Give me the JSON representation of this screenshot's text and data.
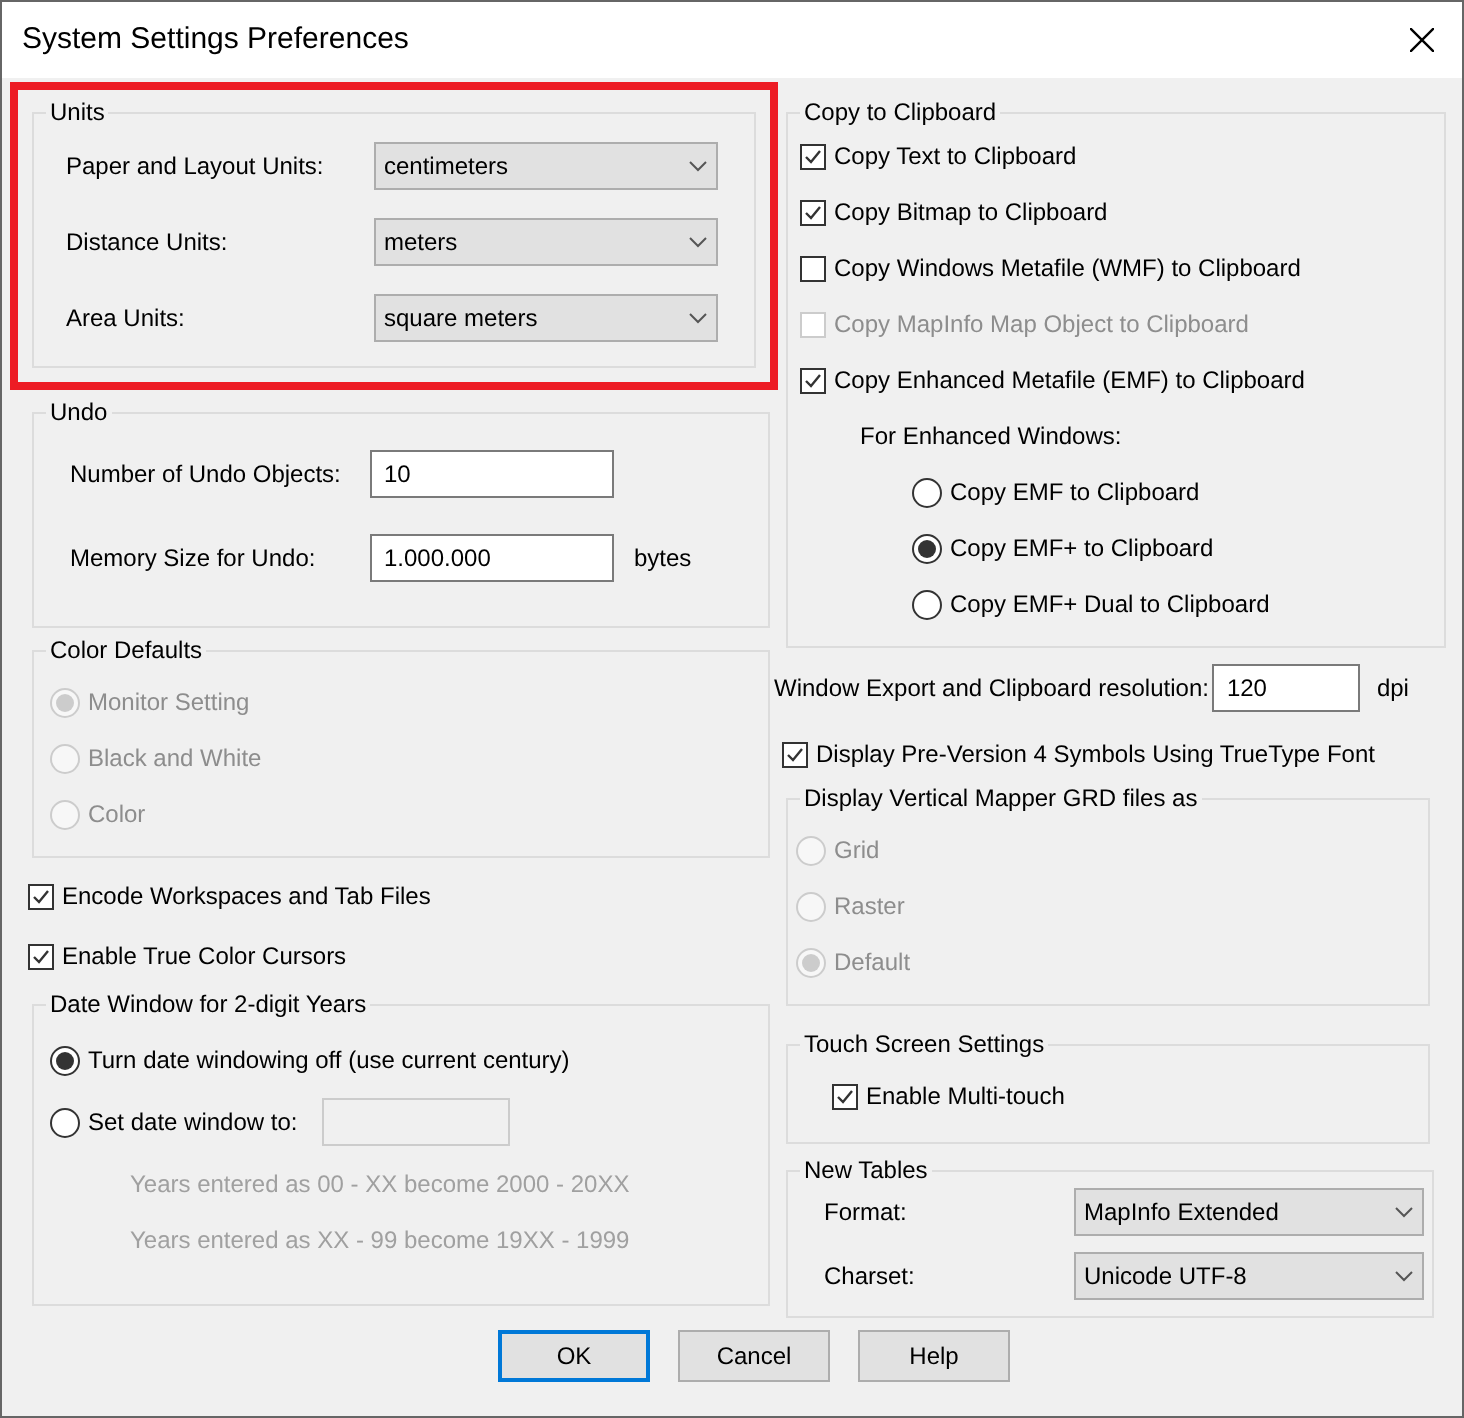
{
  "window": {
    "title": "System Settings Preferences"
  },
  "units": {
    "title": "Units",
    "highlighted": true,
    "fields": [
      {
        "label": "Paper and Layout Units:",
        "value": "centimeters"
      },
      {
        "label": "Distance Units:",
        "value": "meters"
      },
      {
        "label": "Area Units:",
        "value": "square meters"
      }
    ]
  },
  "undo": {
    "title": "Undo",
    "fields": [
      {
        "label": "Number of Undo Objects:",
        "value": "10"
      },
      {
        "label": "Memory Size for Undo:",
        "value": "1.000.000",
        "unit": "bytes"
      }
    ]
  },
  "color_defaults": {
    "title": "Color Defaults",
    "disabled": true,
    "options": [
      {
        "label": "Monitor Setting",
        "selected": true
      },
      {
        "label": "Black and White",
        "selected": false
      },
      {
        "label": "Color",
        "selected": false
      }
    ]
  },
  "options": [
    {
      "label": "Encode Workspaces and Tab Files",
      "checked": true
    },
    {
      "label": "Enable True Color Cursors",
      "checked": true
    }
  ],
  "date_window": {
    "title": "Date Window for 2-digit Years",
    "options": [
      {
        "label": "Turn date windowing off (use current century)",
        "selected": true,
        "kind": "plain"
      },
      {
        "label": "Set date window to:",
        "selected": false,
        "kind": "field"
      }
    ],
    "notes": [
      "Years entered as 00 - XX become 2000 - 20XX",
      "Years entered as XX - 99 become 19XX - 1999"
    ]
  },
  "copy_to_clipboard": {
    "title": "Copy to Clipboard",
    "items": [
      {
        "label": "Copy Text to Clipboard",
        "checked": true,
        "disabled": false
      },
      {
        "label": "Copy Bitmap to Clipboard",
        "checked": true,
        "disabled": false
      },
      {
        "label": "Copy Windows Metafile (WMF) to Clipboard",
        "checked": false,
        "disabled": false
      },
      {
        "label": "Copy MapInfo Map Object to Clipboard",
        "checked": false,
        "disabled": true
      },
      {
        "label": "Copy Enhanced Metafile (EMF) to Clipboard",
        "checked": true,
        "disabled": false
      }
    ],
    "subtitle": "For Enhanced Windows:",
    "options": [
      {
        "label": "Copy EMF to Clipboard",
        "selected": false
      },
      {
        "label": "Copy EMF+ to Clipboard",
        "selected": true
      },
      {
        "label": "Copy EMF+ Dual to Clipboard",
        "selected": false
      }
    ]
  },
  "resolution": {
    "label": "Window Export and Clipboard resolution:",
    "value": "120",
    "unit": "dpi"
  },
  "pre_version_symbols": {
    "label": "Display Pre-Version 4 Symbols Using TrueType Font",
    "checked": true
  },
  "grd": {
    "title": "Display Vertical Mapper GRD files as",
    "disabled": true,
    "options": [
      {
        "label": "Grid",
        "selected": false
      },
      {
        "label": "Raster",
        "selected": false
      },
      {
        "label": "Default",
        "selected": true
      }
    ]
  },
  "touch": {
    "title": "Touch Screen Settings",
    "label": "Enable Multi-touch",
    "checked": true
  },
  "new_tables": {
    "title": "New Tables",
    "fields": [
      {
        "label": "Format:",
        "value": "MapInfo Extended"
      },
      {
        "label": "Charset:",
        "value": "Unicode UTF-8"
      }
    ]
  },
  "buttons": [
    {
      "label": "OK",
      "default": true
    },
    {
      "label": "Cancel",
      "default": false
    },
    {
      "label": "Help",
      "default": false
    }
  ]
}
